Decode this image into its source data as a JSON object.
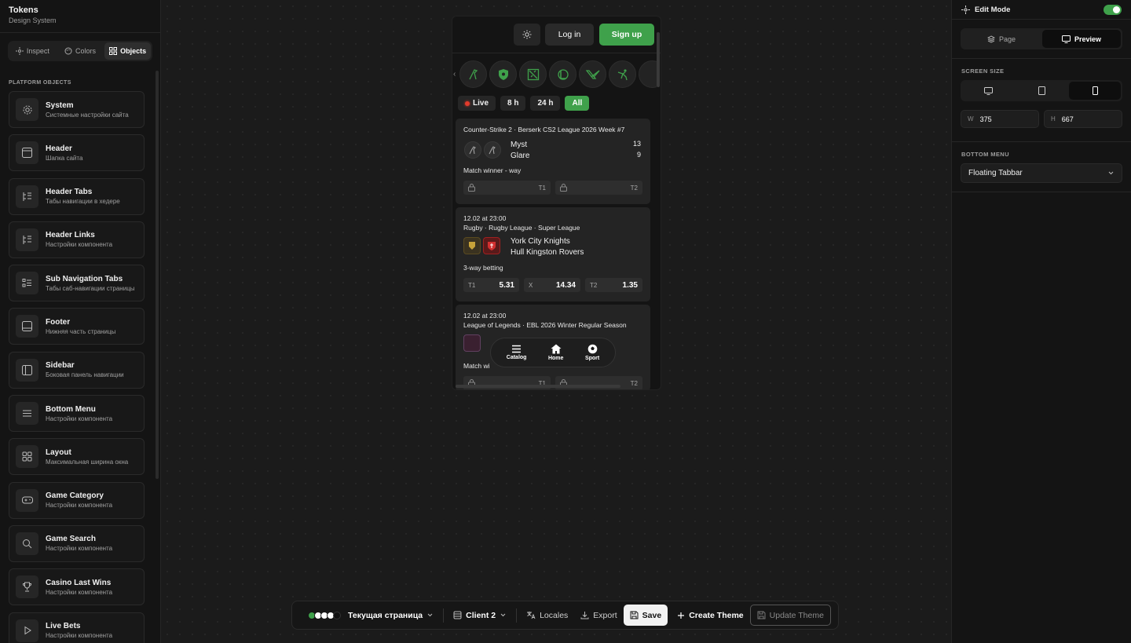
{
  "sidebar": {
    "brand_title": "Tokens",
    "brand_sub": "Design System",
    "tabs": [
      {
        "label": "Inspect",
        "icon": "inspect-icon"
      },
      {
        "label": "Colors",
        "icon": "palette-icon"
      },
      {
        "label": "Objects",
        "icon": "grid-icon",
        "active": true
      }
    ],
    "section_label": "PLATFORM OBJECTS",
    "objects": [
      {
        "title": "System",
        "desc": "Системные настройки сайта",
        "icon": "gear-icon"
      },
      {
        "title": "Header",
        "desc": "Шапка сайта",
        "icon": "header-layout-icon"
      },
      {
        "title": "Header Tabs",
        "desc": "Табы навигации в хедере",
        "icon": "list-tree-icon"
      },
      {
        "title": "Header Links",
        "desc": "Настройки компонента",
        "icon": "list-tree-icon"
      },
      {
        "title": "Sub Navigation Tabs",
        "desc": "Табы саб-навигации страницы",
        "icon": "list-checks-icon"
      },
      {
        "title": "Footer",
        "desc": "Нижняя часть страницы",
        "icon": "footer-layout-icon"
      },
      {
        "title": "Sidebar",
        "desc": "Боковая панель навигации",
        "icon": "sidebar-layout-icon"
      },
      {
        "title": "Bottom Menu",
        "desc": "Настройки компонента",
        "icon": "menu-icon"
      },
      {
        "title": "Layout",
        "desc": "Максимальная ширина окна",
        "icon": "grid-icon"
      },
      {
        "title": "Game Category",
        "desc": "Настройки компонента",
        "icon": "gamepad-icon"
      },
      {
        "title": "Game Search",
        "desc": "Настройки компонента",
        "icon": "search-icon"
      },
      {
        "title": "Casino Last Wins",
        "desc": "Настройки компонента",
        "icon": "trophy-icon"
      },
      {
        "title": "Live Bets",
        "desc": "Настройки компонента",
        "icon": "play-icon"
      }
    ]
  },
  "preview": {
    "login_label": "Log in",
    "signup_label": "Sign up",
    "filters": [
      "Live",
      "8 h",
      "24 h",
      "All"
    ],
    "matches": [
      {
        "title": "Counter-Strike 2 · Berserk CS2 League 2026 Week #7",
        "team1": "Myst",
        "team2": "Glare",
        "score1": "13",
        "score2": "9",
        "market": "Match winner - way",
        "odds": [
          {
            "label": "T1",
            "value": ""
          },
          {
            "label": "T2",
            "value": ""
          }
        ]
      },
      {
        "time": "12.02 at 23:00",
        "title": "Rugby · Rugby League · Super League",
        "team1": "York City Knights",
        "team2": "Hull Kingston Rovers",
        "market": "3-way betting",
        "odds": [
          {
            "label": "T1",
            "value": "5.31"
          },
          {
            "label": "X",
            "value": "14.34"
          },
          {
            "label": "T2",
            "value": "1.35"
          }
        ]
      },
      {
        "time": "12.02 at 23:00",
        "title": "League of Legends · EBL 2026 Winter Regular Season",
        "market": "Match wi",
        "odds": [
          {
            "label": "T1",
            "value": ""
          },
          {
            "label": "T2",
            "value": ""
          }
        ]
      }
    ],
    "tabbar": [
      {
        "label": "Catalog",
        "icon": "menu-icon"
      },
      {
        "label": "Home",
        "icon": "home-icon"
      },
      {
        "label": "Sport",
        "icon": "soccer-ball-icon"
      }
    ]
  },
  "toolbar": {
    "page_label": "Текущая страница",
    "client_label": "Client 2",
    "locales_label": "Locales",
    "export_label": "Export",
    "save_label": "Save",
    "create_label": "Create Theme",
    "update_label": "Update Theme",
    "theme_dots": [
      "#3fa14b",
      "#ffffff",
      "#ffffff",
      "#ffffff",
      "#111111"
    ]
  },
  "right": {
    "edit_mode_label": "Edit Mode",
    "view_tabs": [
      {
        "label": "Page",
        "icon": "layers-icon"
      },
      {
        "label": "Preview",
        "icon": "monitor-icon",
        "active": true
      }
    ],
    "screen_size_label": "SCREEN SIZE",
    "width_label": "W",
    "width_value": "375",
    "height_label": "H",
    "height_value": "667",
    "bottom_menu_label": "BOTTOM MENU",
    "bottom_menu_value": "Floating Tabbar"
  },
  "colors": {
    "accent": "#3fa14b",
    "live": "#e23b2c"
  }
}
